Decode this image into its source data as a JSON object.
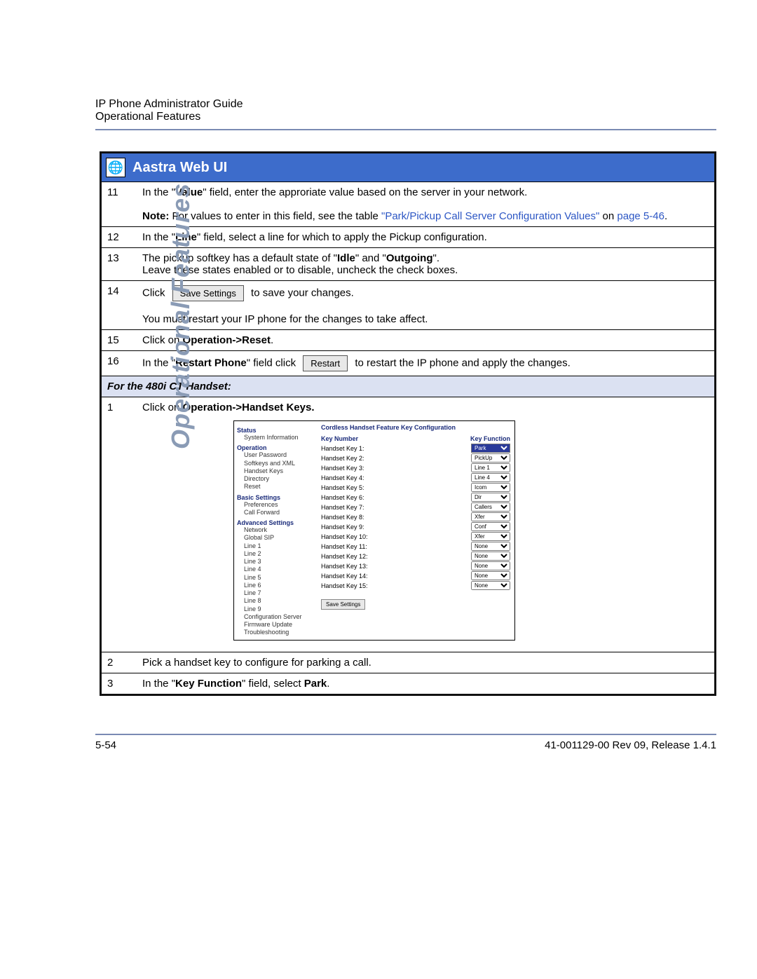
{
  "header": {
    "title": "IP Phone Administrator Guide",
    "subtitle": "Operational Features"
  },
  "side_label": "Operational Features",
  "panel_title": "Aastra Web UI",
  "steps_a": [
    {
      "num": "11",
      "html": "In the \"<b>Value</b>\" field, enter the approriate value based on the server in your network.<br><br><b>Note:</b> For values to enter in this field, see the table <span class='link-blue'>\"Park/Pickup Call Server Configuration Values\"</span> on <span class='link-blue'>page 5-46</span>."
    },
    {
      "num": "12",
      "html": "In the \"<b>Line</b>\" field, select a line for which to apply the Pickup configuration."
    },
    {
      "num": "13",
      "html": "The pickup softkey has a default state of \"<b>Idle</b>\" and \"<b>Outgoing</b>\".<br>Leave these states enabled or to disable, uncheck the check boxes."
    },
    {
      "num": "14",
      "html": "Click <span class='btn-img' data-name='save-settings-button' data-interactable='false'>Save Settings</span> to save your changes.<br><br>You must restart your IP phone for the changes to take affect."
    },
    {
      "num": "15",
      "html": "Click on <b>Operation-&gt;Reset</b>."
    },
    {
      "num": "16",
      "html": "In the \"<b>Restart Phone</b>\" field click <span class='btn-img' data-name='restart-button' data-interactable='false'>Restart</span> to restart the IP phone and apply the changes."
    }
  ],
  "subhead": "For the 480i CT Handset:",
  "steps_b": [
    {
      "num": "1",
      "html": "Click on <b>Operation-&gt;Handset Keys.</b>"
    },
    {
      "num": "2",
      "html": "Pick a handset key to configure for parking a call."
    },
    {
      "num": "3",
      "html": "In the \"<b>Key Function</b>\" field, select <b>Park</b>."
    }
  ],
  "webui": {
    "main_title": "Cordless Handset Feature Key Configuration",
    "col_key": "Key Number",
    "col_func": "Key Function",
    "nav": {
      "cat1": "Status",
      "c1items": [
        "System Information"
      ],
      "cat2": "Operation",
      "c2items": [
        "User Password",
        "Softkeys and XML",
        "Handset Keys",
        "Directory",
        "Reset"
      ],
      "cat3": "Basic Settings",
      "c3items": [
        "Preferences",
        "Call Forward"
      ],
      "cat4": "Advanced Settings",
      "c4items": [
        "Network",
        "Global SIP",
        "Line 1",
        "Line 2",
        "Line 3",
        "Line 4",
        "Line 5",
        "Line 6",
        "Line 7",
        "Line 8",
        "Line 9",
        "Configuration Server",
        "Firmware Update",
        "Troubleshooting"
      ]
    },
    "keys": [
      {
        "label": "Handset Key 1:",
        "value": "Park",
        "selected": true
      },
      {
        "label": "Handset Key 2:",
        "value": "PickUp"
      },
      {
        "label": "Handset Key 3:",
        "value": "Line 1"
      },
      {
        "label": "Handset Key 4:",
        "value": "Line 4"
      },
      {
        "label": "Handset Key 5:",
        "value": "Icom"
      },
      {
        "label": "Handset Key 6:",
        "value": "Dir"
      },
      {
        "label": "Handset Key 7:",
        "value": "Callers"
      },
      {
        "label": "Handset Key 8:",
        "value": "Xfer"
      },
      {
        "label": "Handset Key 9:",
        "value": "Conf"
      },
      {
        "label": "Handset Key 10:",
        "value": "Xfer"
      },
      {
        "label": "Handset Key 11:",
        "value": "None"
      },
      {
        "label": "Handset Key 12:",
        "value": "None"
      },
      {
        "label": "Handset Key 13:",
        "value": "None"
      },
      {
        "label": "Handset Key 14:",
        "value": "None"
      },
      {
        "label": "Handset Key 15:",
        "value": "None"
      }
    ],
    "save_label": "Save Settings"
  },
  "footer": {
    "page": "5-54",
    "doc": "41-001129-00 Rev 09, Release 1.4.1"
  }
}
